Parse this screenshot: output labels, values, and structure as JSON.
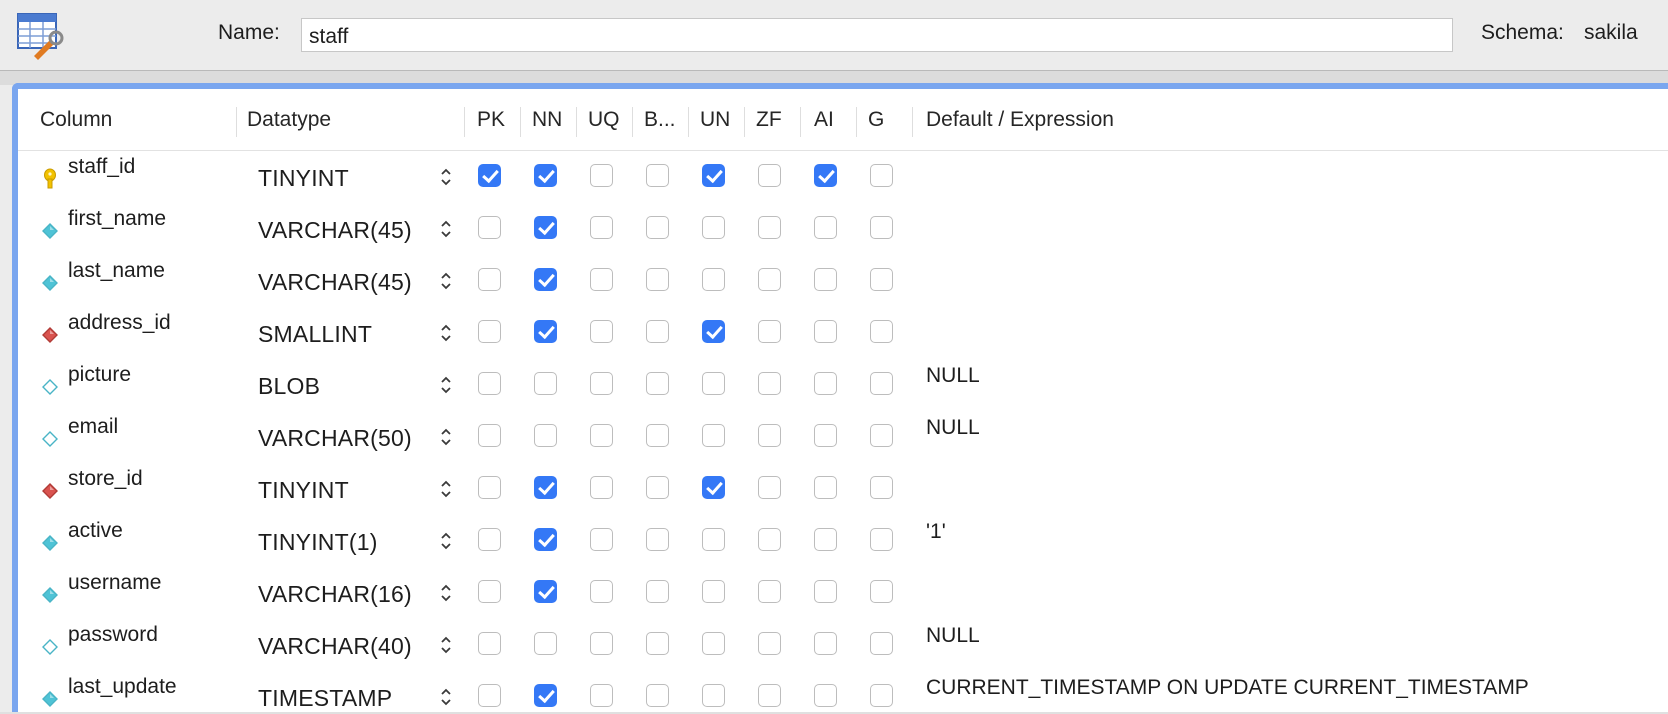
{
  "header": {
    "name_label": "Name:",
    "name_value": "staff",
    "schema_label": "Schema:",
    "schema_value": "sakila"
  },
  "table": {
    "columns": [
      "Column",
      "Datatype",
      "PK",
      "NN",
      "UQ",
      "B...",
      "UN",
      "ZF",
      "AI",
      "G",
      "Default / Expression"
    ],
    "rows": [
      {
        "name": "staff_id",
        "icon": "key-icon",
        "datatype": "TINYINT",
        "flags": [
          true,
          true,
          false,
          false,
          true,
          false,
          true,
          false
        ],
        "default": ""
      },
      {
        "name": "first_name",
        "icon": "diamond-filled-icon",
        "datatype": "VARCHAR(45)",
        "flags": [
          false,
          true,
          false,
          false,
          false,
          false,
          false,
          false
        ],
        "default": ""
      },
      {
        "name": "last_name",
        "icon": "diamond-filled-icon",
        "datatype": "VARCHAR(45)",
        "flags": [
          false,
          true,
          false,
          false,
          false,
          false,
          false,
          false
        ],
        "default": ""
      },
      {
        "name": "address_id",
        "icon": "foreign-key-icon",
        "datatype": "SMALLINT",
        "flags": [
          false,
          true,
          false,
          false,
          true,
          false,
          false,
          false
        ],
        "default": ""
      },
      {
        "name": "picture",
        "icon": "diamond-empty-icon",
        "datatype": "BLOB",
        "flags": [
          false,
          false,
          false,
          false,
          false,
          false,
          false,
          false
        ],
        "default": "NULL"
      },
      {
        "name": "email",
        "icon": "diamond-empty-icon",
        "datatype": "VARCHAR(50)",
        "flags": [
          false,
          false,
          false,
          false,
          false,
          false,
          false,
          false
        ],
        "default": "NULL"
      },
      {
        "name": "store_id",
        "icon": "foreign-key-icon",
        "datatype": "TINYINT",
        "flags": [
          false,
          true,
          false,
          false,
          true,
          false,
          false,
          false
        ],
        "default": ""
      },
      {
        "name": "active",
        "icon": "diamond-filled-icon",
        "datatype": "TINYINT(1)",
        "flags": [
          false,
          true,
          false,
          false,
          false,
          false,
          false,
          false
        ],
        "default": "'1'"
      },
      {
        "name": "username",
        "icon": "diamond-filled-icon",
        "datatype": "VARCHAR(16)",
        "flags": [
          false,
          true,
          false,
          false,
          false,
          false,
          false,
          false
        ],
        "default": ""
      },
      {
        "name": "password",
        "icon": "diamond-empty-icon",
        "datatype": "VARCHAR(40)",
        "flags": [
          false,
          false,
          false,
          false,
          false,
          false,
          false,
          false
        ],
        "default": "NULL"
      },
      {
        "name": "last_update",
        "icon": "diamond-filled-icon",
        "datatype": "TIMESTAMP",
        "flags": [
          false,
          true,
          false,
          false,
          false,
          false,
          false,
          false
        ],
        "default": "CURRENT_TIMESTAMP ON UPDATE CURRENT_TIMESTAMP"
      }
    ]
  },
  "colors": {
    "accent": "#3478f6",
    "frame": "#7aa6ef",
    "key": "#f2c200",
    "foreign_key": "#d9534f",
    "column_diamond": "#4fc3d6"
  }
}
